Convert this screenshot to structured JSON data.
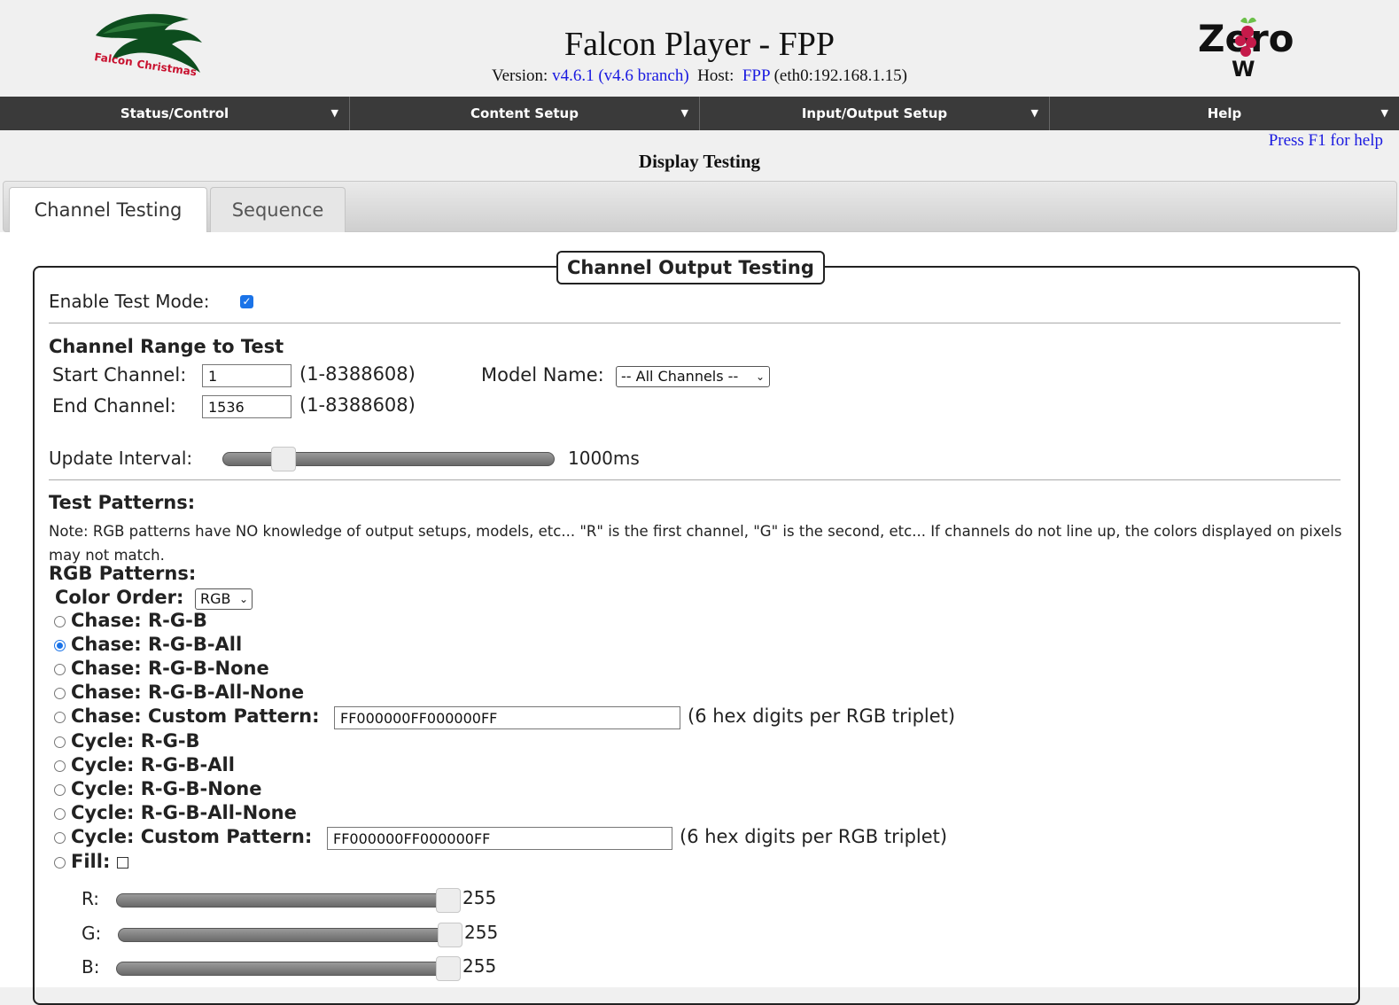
{
  "header": {
    "logo_left_text1": "Falcon",
    "logo_left_text2": "Christmas",
    "title": "Falcon Player - FPP",
    "version_label": "Version:",
    "version_value": "v4.6.1 (v4.6 branch)",
    "host_label": "Host:",
    "host_name": "FPP",
    "host_detail": "(eth0:192.168.1.15)",
    "logo_right_text": "Zero",
    "logo_right_sub": "W"
  },
  "nav": {
    "items": [
      {
        "label": "Status/Control"
      },
      {
        "label": "Content Setup"
      },
      {
        "label": "Input/Output Setup"
      },
      {
        "label": "Help"
      }
    ]
  },
  "help_link": "Press F1 for help",
  "page_title": "Display Testing",
  "tabs": [
    {
      "label": "Channel Testing",
      "active": true
    },
    {
      "label": "Sequence",
      "active": false
    }
  ],
  "panel": {
    "legend": "Channel Output Testing",
    "enable_test_mode_label": "Enable Test Mode:",
    "enable_test_mode_checked": true,
    "range_heading": "Channel Range to Test",
    "start_channel_label": "Start Channel:",
    "start_channel_value": "1",
    "start_channel_range": "(1-8388608)",
    "end_channel_label": "End Channel:",
    "end_channel_value": "1536",
    "end_channel_range": "(1-8388608)",
    "model_name_label": "Model Name:",
    "model_name_value": "-- All Channels --",
    "update_interval_label": "Update Interval:",
    "update_interval_value": "1000ms",
    "update_interval_level": 0.15,
    "test_patterns_heading": "Test Patterns:",
    "note": "Note: RGB patterns have NO knowledge of output setups, models, etc... \"R\" is the first channel, \"G\" is the second, etc... If channels do not line up, the colors displayed on pixels may not match.",
    "rgb_heading": "RGB Patterns:",
    "color_order_label": "Color Order:",
    "color_order_value": "RGB",
    "patterns": [
      {
        "label": "Chase: R-G-B",
        "selected": false
      },
      {
        "label": "Chase: R-G-B-All",
        "selected": true
      },
      {
        "label": "Chase: R-G-B-None",
        "selected": false
      },
      {
        "label": "Chase: R-G-B-All-None",
        "selected": false
      },
      {
        "label": "Chase: Custom Pattern:",
        "selected": false,
        "input": "FF000000FF000000FF",
        "hint": "(6 hex digits per RGB triplet)"
      },
      {
        "label": "Cycle: R-G-B",
        "selected": false
      },
      {
        "label": "Cycle: R-G-B-All",
        "selected": false
      },
      {
        "label": "Cycle: R-G-B-None",
        "selected": false
      },
      {
        "label": "Cycle: R-G-B-All-None",
        "selected": false
      },
      {
        "label": "Cycle: Custom Pattern:",
        "selected": false,
        "input": "FF000000FF000000FF",
        "hint": "(6 hex digits per RGB triplet)"
      },
      {
        "label": "Fill:",
        "selected": false
      }
    ],
    "fill_sliders": [
      {
        "label": "R:",
        "value": "255"
      },
      {
        "label": "G:",
        "value": "255"
      },
      {
        "label": "B:",
        "value": "255"
      }
    ]
  },
  "colors": {
    "nav_bg": "#3a3a3a",
    "link": "#1a1ae0",
    "accent": "#1a73e8"
  }
}
